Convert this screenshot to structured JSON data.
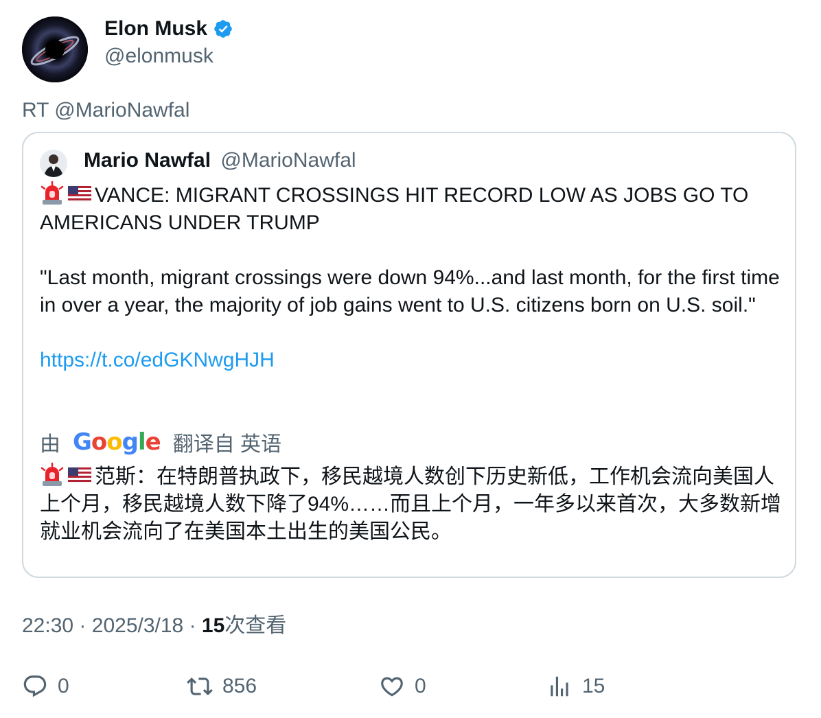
{
  "author": {
    "name": "Elon Musk",
    "handle": "@elonmusk"
  },
  "retweet_line": "RT @MarioNawfal",
  "quoted_tweet": {
    "author_name": "Mario Nawfal",
    "author_handle": "@MarioNawfal",
    "headline": "VANCE: MIGRANT CROSSINGS HIT RECORD LOW AS JOBS GO TO AMERICANS UNDER TRUMP",
    "quote": "\"Last month, migrant crossings were down 94%...and last month, for the first time in over a year, the majority of job gains went to U.S. citizens born on U.S. soil.\"",
    "link": "https://t.co/edGKNwgHJH",
    "translation_prefix": "由",
    "translation_provider": "Google",
    "translation_suffix": "翻译自 英语",
    "translated_text": "范斯：在特朗普执政下，移民越境人数创下历史新低，工作机会流向美国人 上个月，移民越境人数下降了94%……而且上个月，一年多以来首次，大多数新增就业机会流向了在美国本土出生的美国公民。"
  },
  "meta": {
    "time": "22:30",
    "separator": "·",
    "date": "2025/3/18",
    "views_count": "15",
    "views_label": "次查看"
  },
  "actions": {
    "replies": "0",
    "retweets": "856",
    "likes": "0",
    "views": "15"
  },
  "colors": {
    "text": "#0f1419",
    "secondary": "#536471",
    "link": "#1d9bf0",
    "border": "#cfd9de",
    "verified": "#1d9bf0"
  },
  "icons": [
    "verified-badge-icon",
    "siren-emoji-icon",
    "us-flag-emoji-icon",
    "reply-icon",
    "retweet-icon",
    "like-icon",
    "views-icon"
  ]
}
